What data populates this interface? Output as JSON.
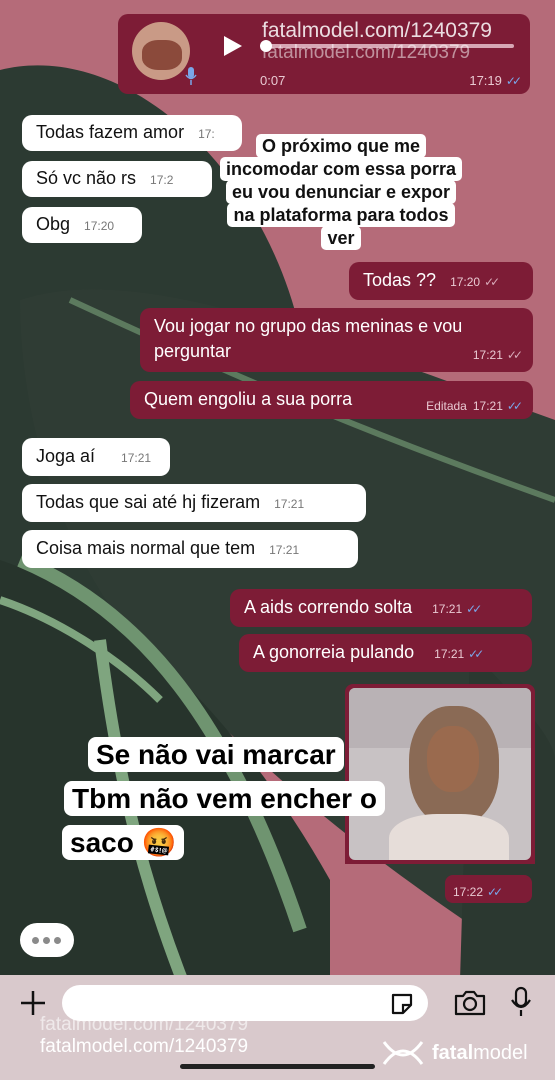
{
  "audio": {
    "duration": "0:07",
    "time": "17:19"
  },
  "watermark_top": {
    "line1": "fatalmodel.com/1240379",
    "line2": "fatalmodel.com/1240379"
  },
  "sticker_top": {
    "lines": [
      "O próximo que me",
      "incomodar com essa porra",
      "eu vou denunciar e expor",
      "na plataforma  para todos",
      "ver"
    ]
  },
  "sticker_bottom": {
    "line1": "Se não vai marcar",
    "line2": "Tbm não vem encher o",
    "line3": "saco 🤬"
  },
  "messages": [
    {
      "text": "Todas fazem amor",
      "time": "17:",
      "dir": "in"
    },
    {
      "text": "Só vc não rs",
      "time": "17:2",
      "dir": "in"
    },
    {
      "text": "Obg",
      "time": "17:20",
      "dir": "in"
    },
    {
      "text": "Todas ??",
      "time": "17:20",
      "dir": "out",
      "read": false
    },
    {
      "text": "Vou jogar no grupo das meninas e vou perguntar",
      "time": "17:21",
      "dir": "out",
      "read": false
    },
    {
      "text": "Quem engoliu a sua porra",
      "edited_label": "Editada",
      "time": "17:21",
      "dir": "out",
      "read": true
    },
    {
      "text": "Joga aí",
      "time": "17:21",
      "dir": "in"
    },
    {
      "text": "Todas que sai até hj fizeram",
      "time": "17:21",
      "dir": "in"
    },
    {
      "text": "Coisa mais normal que tem",
      "time": "17:21",
      "dir": "in"
    },
    {
      "text": "A aids correndo solta",
      "time": "17:21",
      "dir": "out",
      "read": true
    },
    {
      "text": "A gonorreia pulando",
      "time": "17:21",
      "dir": "out",
      "read": true
    }
  ],
  "photo_message": {
    "time": "17:22",
    "read": true
  },
  "input": {
    "value": ""
  },
  "watermark_bottom": {
    "line1": "fatalmodel.com/1240379",
    "line2": "fatalmodel.com/1240379"
  },
  "brand": {
    "name_bold": "fatal",
    "name_regular": "model"
  },
  "colors": {
    "outgoing": "#7d1c36",
    "incoming": "#ffffff",
    "read_ticks": "#7aa6e8",
    "background": "#b56b79"
  },
  "icons": [
    "play-icon",
    "microphone-icon",
    "typing-indicator-icon",
    "plus-icon",
    "sticker-icon",
    "camera-icon",
    "mic-icon",
    "fatalmodel-logo-icon"
  ]
}
